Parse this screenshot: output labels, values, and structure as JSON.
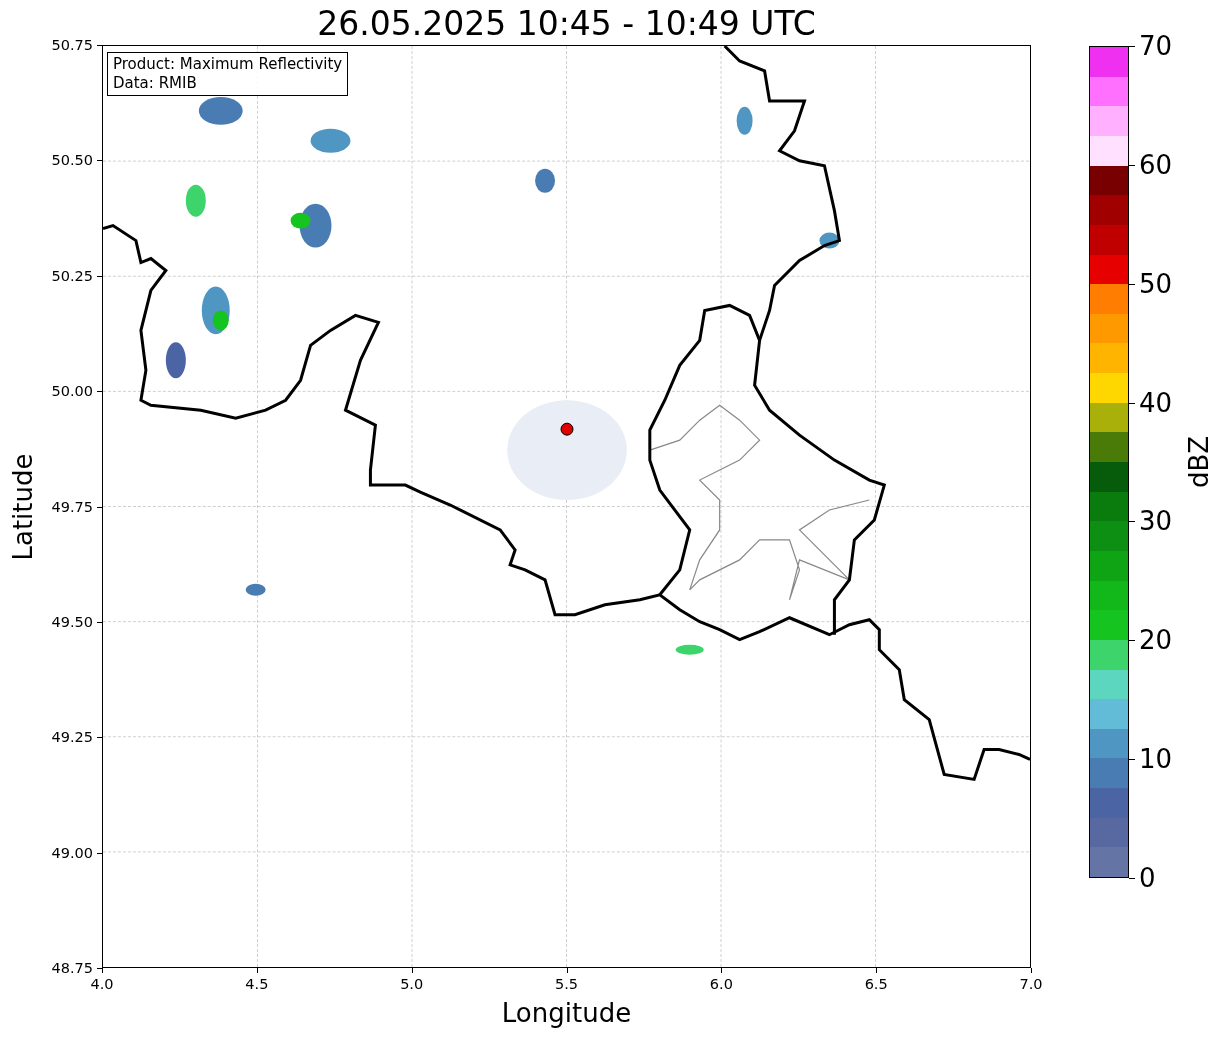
{
  "title": "26.05.2025 10:45 - 10:49 UTC",
  "map": {
    "legend": [
      "Product: Maximum Reflectivity",
      "Data: RMIB"
    ],
    "xlabel": "Longitude",
    "ylabel": "Latitude",
    "xticks": [
      "4.0",
      "4.5",
      "5.0",
      "5.5",
      "6.0",
      "6.5",
      "7.0"
    ],
    "yticks": [
      "50.75",
      "50.50",
      "50.25",
      "50.00",
      "49.75",
      "49.50",
      "49.25",
      "49.00",
      "48.75"
    ]
  },
  "colorbar": {
    "label": "dBZ",
    "ticks": [
      "70",
      "60",
      "50",
      "40",
      "30",
      "20",
      "10",
      "0"
    ],
    "bands": [
      {
        "color": "#6474a4"
      },
      {
        "color": "#5868a0"
      },
      {
        "color": "#4a64a4"
      },
      {
        "color": "#4a7cb4"
      },
      {
        "color": "#4f97c2"
      },
      {
        "color": "#62bcd8"
      },
      {
        "color": "#5dd6c0"
      },
      {
        "color": "#3dd46c"
      },
      {
        "color": "#15c41e"
      },
      {
        "color": "#12b81a"
      },
      {
        "color": "#0ea414"
      },
      {
        "color": "#0c8f12"
      },
      {
        "color": "#0a7c0e"
      },
      {
        "color": "#065c0a"
      },
      {
        "color": "#4a7a07"
      },
      {
        "color": "#aab00a"
      },
      {
        "color": "#ffd700"
      },
      {
        "color": "#ffb400"
      },
      {
        "color": "#ff9900"
      },
      {
        "color": "#ff7d00"
      },
      {
        "color": "#e60000"
      },
      {
        "color": "#c00000"
      },
      {
        "color": "#a00000"
      },
      {
        "color": "#780000"
      },
      {
        "color": "#ffe0ff"
      },
      {
        "color": "#ffb0ff"
      },
      {
        "color": "#ff70ff"
      },
      {
        "color": "#f030f0"
      }
    ]
  }
}
